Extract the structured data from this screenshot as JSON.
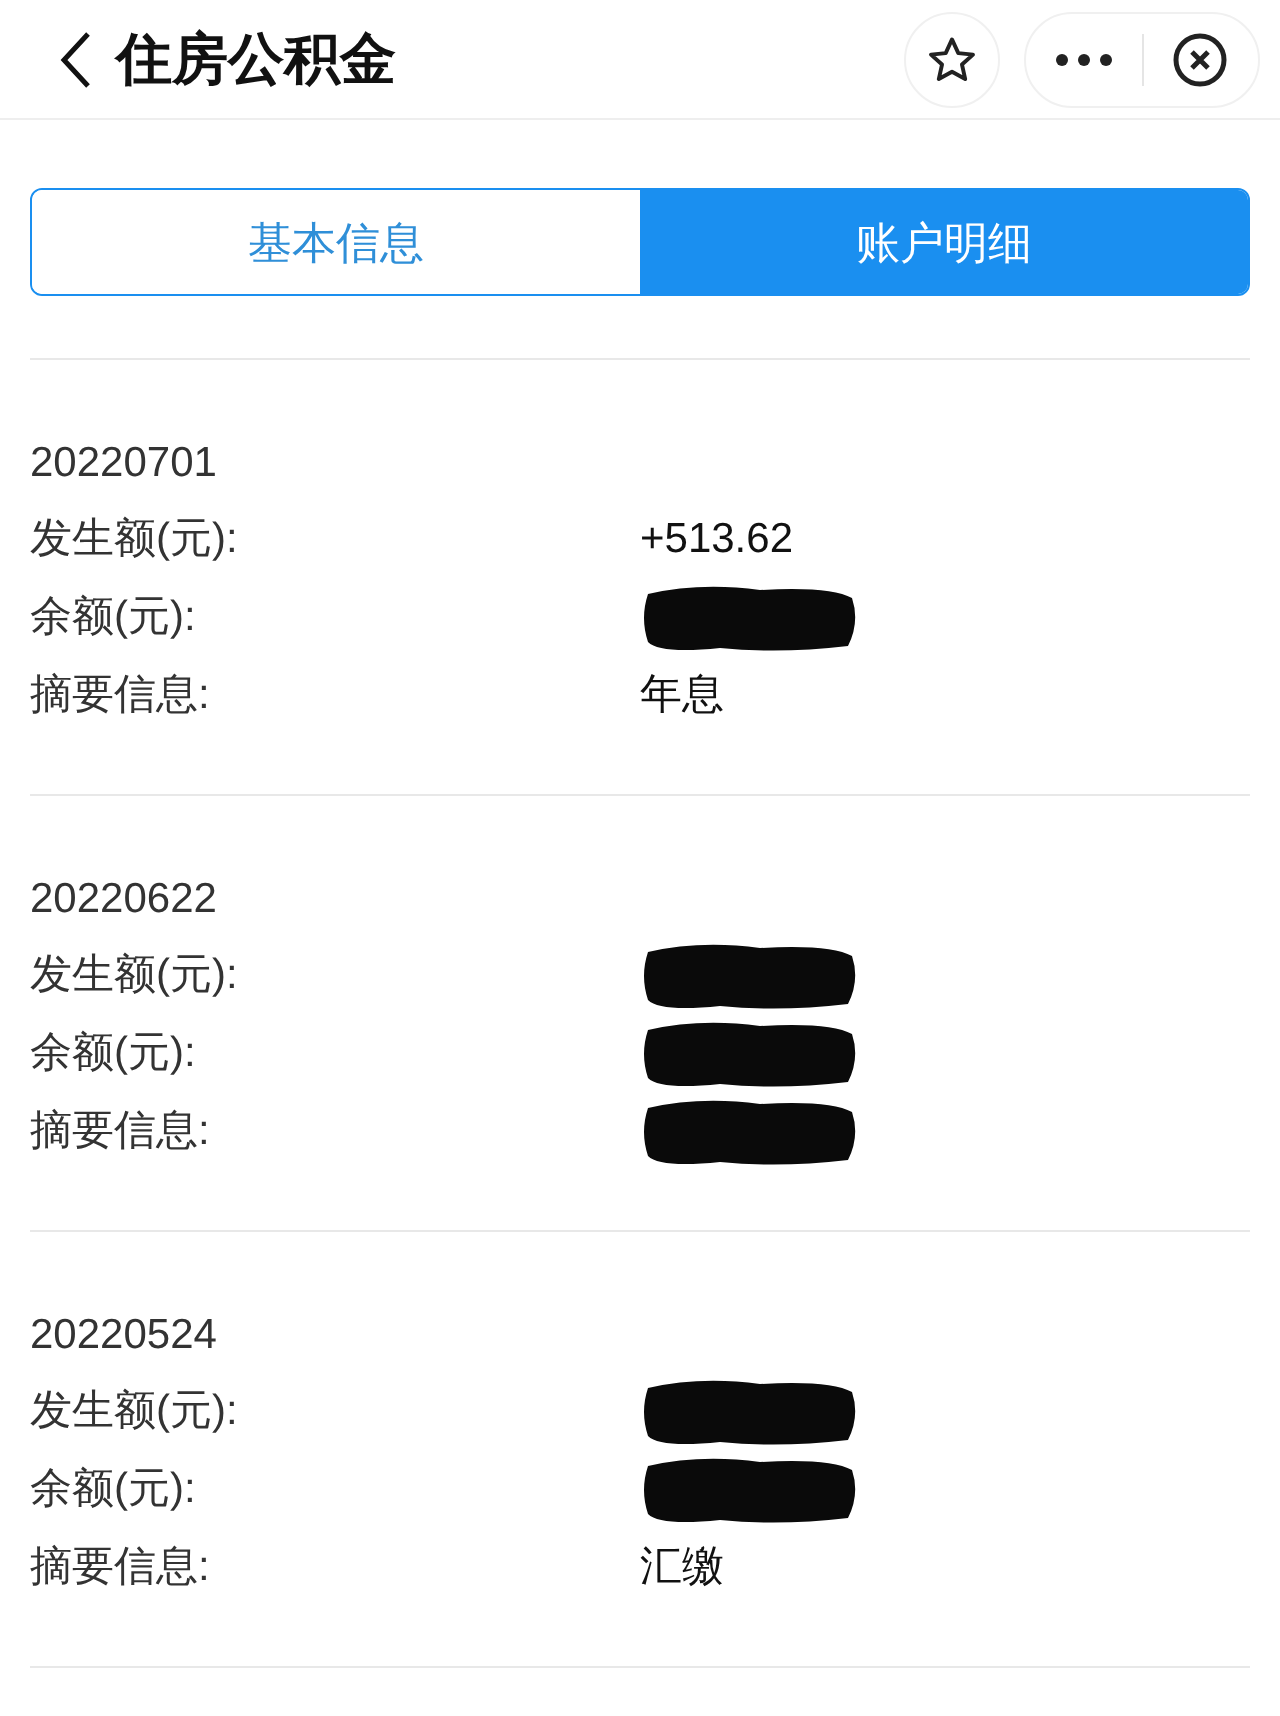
{
  "nav": {
    "title": "住房公积金"
  },
  "tabs": [
    {
      "label": "基本信息",
      "selected": false
    },
    {
      "label": "账户明细",
      "selected": true
    }
  ],
  "records": [
    {
      "date": "20220701",
      "fields": [
        {
          "label": "发生额(元):",
          "value": "+513.62",
          "redacted": false
        },
        {
          "label": "余额(元):",
          "redacted": true
        },
        {
          "label": "摘要信息:",
          "value": "年息",
          "redacted": false
        }
      ]
    },
    {
      "date": "20220622",
      "fields": [
        {
          "label": "发生额(元):",
          "redacted": true
        },
        {
          "label": "余额(元):",
          "redacted": true
        },
        {
          "label": "摘要信息:",
          "redacted": true
        }
      ]
    },
    {
      "date": "20220524",
      "fields": [
        {
          "label": "发生额(元):",
          "redacted": true
        },
        {
          "label": "余额(元):",
          "redacted": true
        },
        {
          "label": "摘要信息:",
          "value": "汇缴",
          "redacted": false
        }
      ]
    }
  ]
}
